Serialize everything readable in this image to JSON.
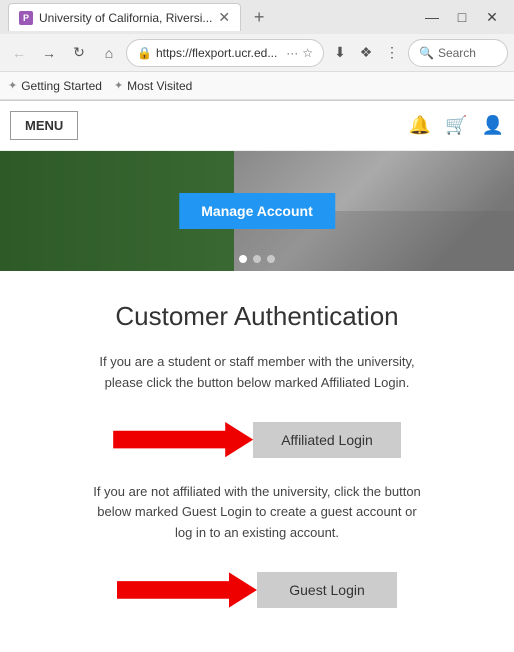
{
  "browser": {
    "tab": {
      "title": "University of California, Riversi...",
      "favicon_label": "P"
    },
    "address": "https://flexport.ucr.ed...",
    "address_full": "https://flexport.ucr.ed",
    "search_placeholder": "Search",
    "new_tab_label": "+",
    "window_controls": {
      "minimize": "—",
      "maximize": "□",
      "close": "✕"
    }
  },
  "bookmarks": {
    "getting_started": "Getting Started",
    "most_visited": "Most Visited"
  },
  "site": {
    "menu_label": "MENU",
    "hero": {
      "manage_button": "Manage Account",
      "dots": [
        true,
        false,
        false
      ]
    },
    "auth": {
      "title": "Customer Authentication",
      "affiliated_desc": "If you are a student or staff member with the university, please click the button below marked Affiliated Login.",
      "affiliated_button": "Affiliated Login",
      "guest_desc": "If you are not affiliated with the university, click the button below marked Guest Login to create a guest account or log in to an existing account.",
      "guest_button": "Guest Login"
    }
  }
}
